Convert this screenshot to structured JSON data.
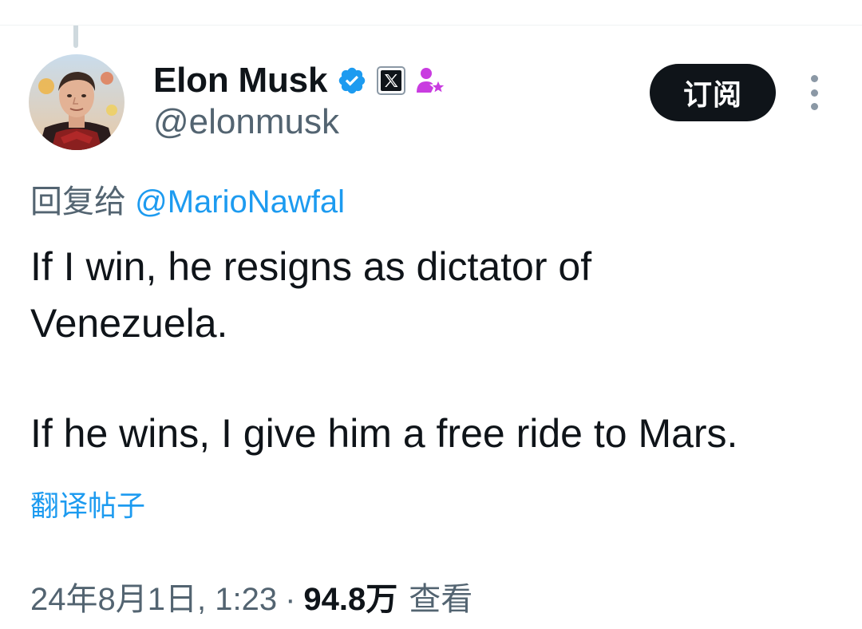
{
  "author": {
    "display_name": "Elon Musk",
    "handle": "@elonmusk",
    "badges": [
      "verified-checkmark-icon",
      "x-affiliate-icon",
      "creator-star-icon"
    ]
  },
  "actions": {
    "subscribe_label": "订阅",
    "more_icon": "more-vertical-icon"
  },
  "reply": {
    "prefix": "回复给",
    "mention": "@MarioNawfal"
  },
  "tweet": {
    "lines": [
      "If I win, he resigns as dictator of",
      "Venezuela.",
      "If he wins, I give him a free ride to Mars."
    ]
  },
  "translate_label": "翻译帖子",
  "meta": {
    "timestamp": "24年8月1日, 1:23",
    "separator": "·",
    "views_count": "94.8万",
    "views_label": "查看"
  },
  "colors": {
    "link_blue": "#1d9bf0",
    "text_primary": "#0f1419",
    "text_secondary": "#536471",
    "button_dark": "#0f1419",
    "creator_badge": "#c93ce0"
  }
}
